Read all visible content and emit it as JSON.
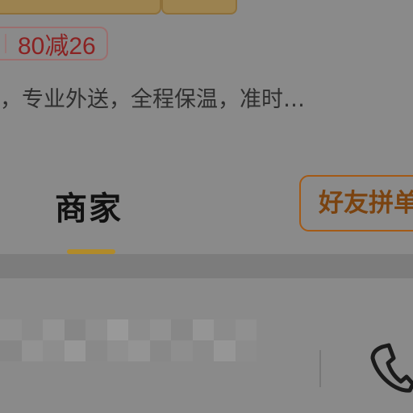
{
  "coupon": {
    "text": "80减26"
  },
  "store": {
    "description": "，专业外送，全程保温，准时…"
  },
  "tabs": {
    "merchant_label": "商家"
  },
  "group_buy": {
    "label": "好友拼单"
  },
  "colors": {
    "overlay": "#8a8a8a",
    "coupon_text": "#8a2222",
    "tab_underline": "#b08a2a",
    "group_buy_text": "#7a4310"
  },
  "icons": {
    "phone": "phone-icon"
  }
}
